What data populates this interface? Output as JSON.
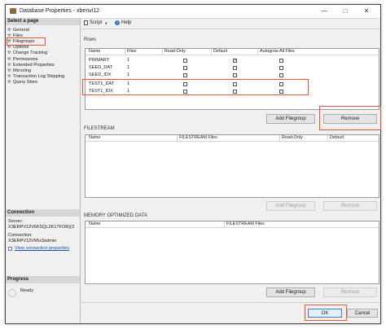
{
  "window": {
    "title": "Database Properties - xbenvi12"
  },
  "left_panel": {
    "select_page_header": "Select a page",
    "pages": [
      {
        "label": "General"
      },
      {
        "label": "Files"
      },
      {
        "label": "Filegroups"
      },
      {
        "label": "Options"
      },
      {
        "label": "Change Tracking"
      },
      {
        "label": "Permissions"
      },
      {
        "label": "Extended Properties"
      },
      {
        "label": "Mirroring"
      },
      {
        "label": "Transaction Log Shipping"
      },
      {
        "label": "Query Store"
      }
    ],
    "connection_header": "Connection",
    "server_label": "Server:",
    "server_value": "X3ERPV12VM\\SQL2K17FOR)(3",
    "connection_label": "Connection:",
    "connection_value": "X3ERPV12VM\\x3admin",
    "view_link": "View connection properties",
    "progress_header": "Progress",
    "progress_status": "Ready"
  },
  "toolbar": {
    "script": "Script",
    "help": "Help"
  },
  "rows_section": {
    "label": "Rows",
    "columns": [
      "Name",
      "Files",
      "Read-Only",
      "Default",
      "Autogrow All Files"
    ],
    "rows": [
      {
        "name": "PRIMARY",
        "files": "1",
        "read_only": false,
        "default": true,
        "autogrow": false
      },
      {
        "name": "SEED_DAT",
        "files": "1",
        "read_only": false,
        "default": false,
        "autogrow": false
      },
      {
        "name": "SEED_IDX",
        "files": "1",
        "read_only": false,
        "default": false,
        "autogrow": false
      },
      {
        "name": "TEST1_DAT",
        "files": "1",
        "read_only": false,
        "default": false,
        "autogrow": false
      },
      {
        "name": "TEST1_IDX",
        "files": "1",
        "read_only": false,
        "default": false,
        "autogrow": false
      }
    ],
    "add_button": "Add Filegroup",
    "remove_button": "Remove"
  },
  "filestream_section": {
    "label": "FILESTREAM",
    "columns": [
      "Name",
      "FILESTREAM Files",
      "Read-Only",
      "Default"
    ],
    "add_button": "Add Filegroup",
    "remove_button": "Remove"
  },
  "memory_section": {
    "label": "MEMORY OPTIMIZED DATA",
    "columns": [
      "Name",
      "FILESTREAM Files"
    ],
    "add_button": "Add Filegroup",
    "remove_button": "Remove"
  },
  "footer": {
    "ok": "OK",
    "cancel": "Cancel"
  }
}
